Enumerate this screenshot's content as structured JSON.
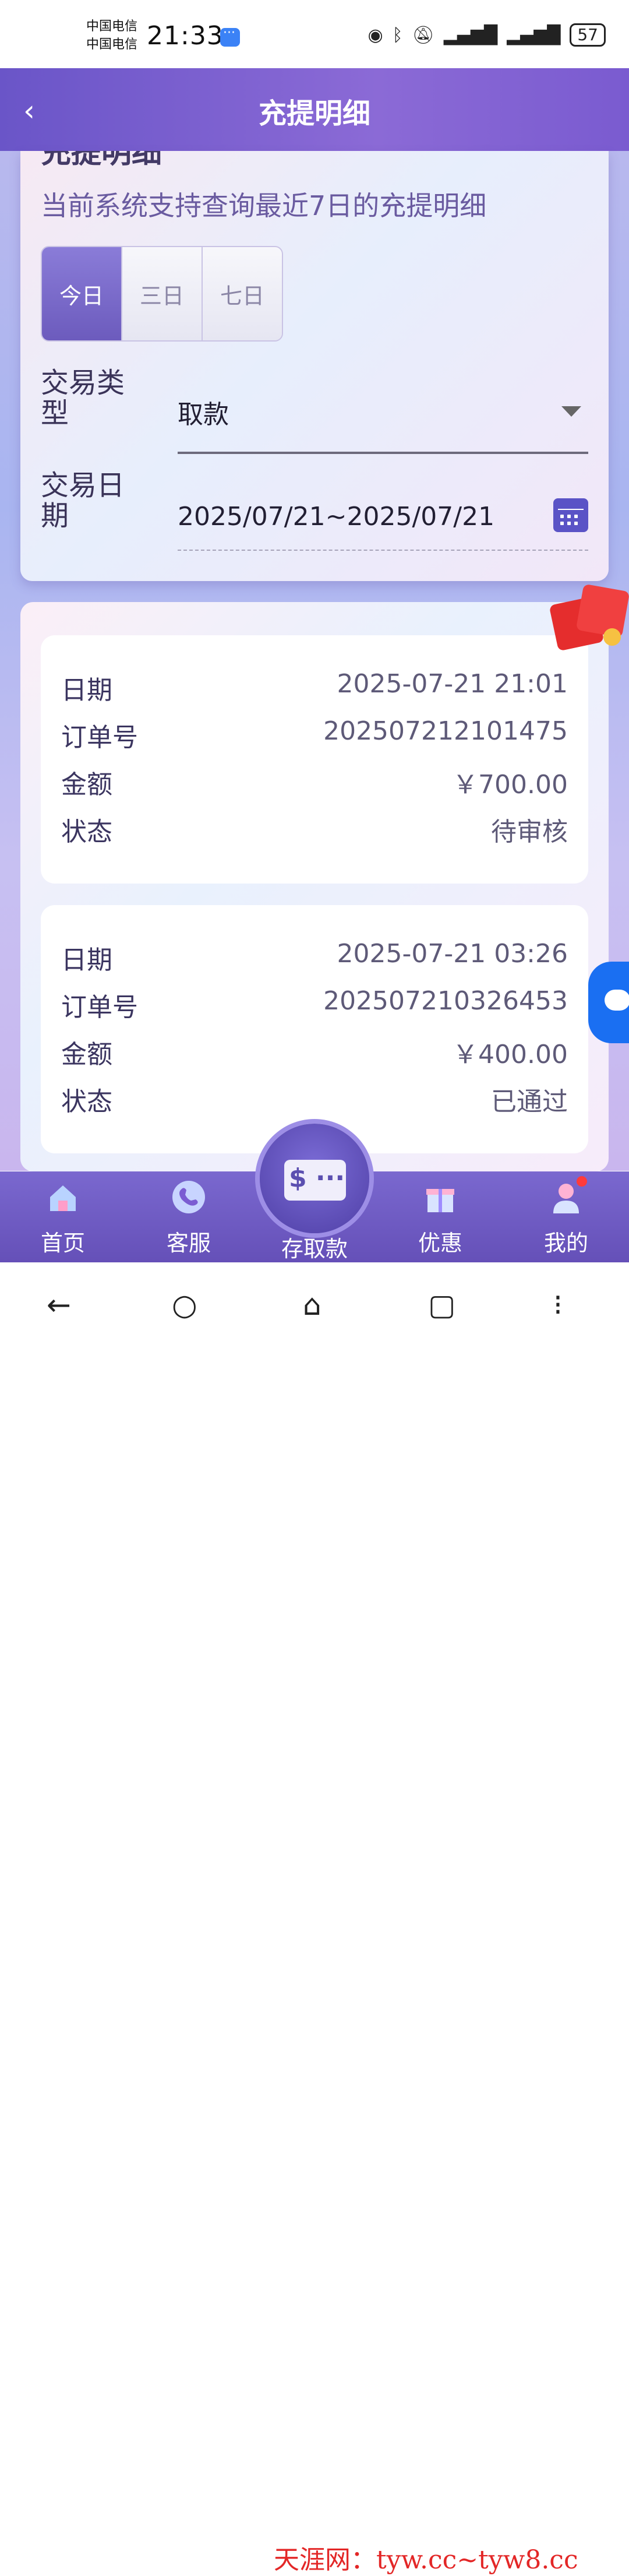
{
  "status_bar": {
    "carrier_1": "中国电信",
    "carrier_2": "中国电信",
    "time": "21:33",
    "battery": "57"
  },
  "header": {
    "title": "充提明细"
  },
  "filter": {
    "partial_title": "充提明细",
    "hint": "当前系统支持查询最近7日的充提明细",
    "tabs": [
      {
        "label": "今日",
        "active": true
      },
      {
        "label": "三日",
        "active": false
      },
      {
        "label": "七日",
        "active": false
      }
    ],
    "type_label": "交易类型",
    "type_value": "取款",
    "date_label": "交易日期",
    "date_value": "2025/07/21~2025/07/21"
  },
  "records": [
    {
      "date_key": "日期",
      "date": "2025-07-21 21:01",
      "order_key": "订单号",
      "order": "202507212101475",
      "amount_key": "金额",
      "amount": "￥700.00",
      "status_key": "状态",
      "status": "待审核"
    },
    {
      "date_key": "日期",
      "date": "2025-07-21 03:26",
      "order_key": "订单号",
      "order": "202507210326453",
      "amount_key": "金额",
      "amount": "￥400.00",
      "status_key": "状态",
      "status": "已通过"
    }
  ],
  "bottom_nav": {
    "items": [
      {
        "label": "首页",
        "icon": "home-icon"
      },
      {
        "label": "客服",
        "icon": "phone-icon"
      },
      {
        "label": "存取款",
        "icon": "wallet-icon"
      },
      {
        "label": "优惠",
        "icon": "gift-icon"
      },
      {
        "label": "我的",
        "icon": "user-icon"
      }
    ]
  },
  "watermark": "天涯网：tyw.cc~tyw8.cc",
  "colors": {
    "header": "#7a5bd0",
    "accent": "#6c5bbd",
    "nav": "#6e5ac4"
  }
}
